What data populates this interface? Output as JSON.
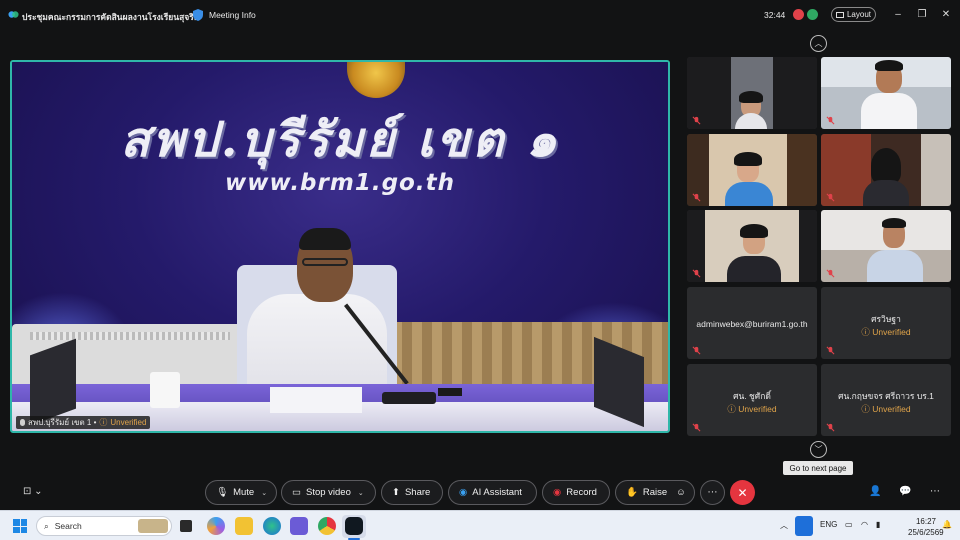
{
  "titlebar": {
    "title": "ประชุมคณะกรรมการคัดสินผลงานโรงเรียนสุจริต",
    "meeting_info": "Meeting Info",
    "timer": "32:44",
    "layout_label": "Layout"
  },
  "stage": {
    "banner_title": "สพป.บุรีรัมย์ เขต ๑",
    "banner_url": "www.brm1.go.th",
    "speaker_name": "สพป.บุรีรัมย์ เขต 1 •",
    "speaker_status": "Unverified"
  },
  "participants": [
    {
      "name": "",
      "status": "",
      "video": true
    },
    {
      "name": "",
      "status": "",
      "video": true
    },
    {
      "name": "",
      "status": "",
      "video": true
    },
    {
      "name": "",
      "status": "",
      "video": true
    },
    {
      "name": "",
      "status": "",
      "video": true
    },
    {
      "name": "",
      "status": "",
      "video": true
    },
    {
      "name": "adminwebex@buriram1.go.th",
      "status": "",
      "video": false
    },
    {
      "name": "ศรวิษฐา",
      "status": "Unverified",
      "video": false
    },
    {
      "name": "ศน. ชูศักดิ์",
      "status": "Unverified",
      "video": false
    },
    {
      "name": "ศน.กฤษขจร ศรีถาวร บร.1",
      "status": "Unverified",
      "video": false
    }
  ],
  "tooltip": "Go to next page",
  "controls": {
    "mute": "Mute",
    "stop_video": "Stop video",
    "share": "Share",
    "ai_assistant": "AI Assistant",
    "record": "Record",
    "raise": "Raise"
  },
  "taskbar": {
    "search_placeholder": "Search",
    "language": "ENG",
    "time": "16:27",
    "date": "25/6/2569"
  },
  "colors": {
    "accent_border": "#2fb7a9",
    "end_call": "#e5353f",
    "unverified": "#e0a44a",
    "muted": "#e0424a"
  }
}
